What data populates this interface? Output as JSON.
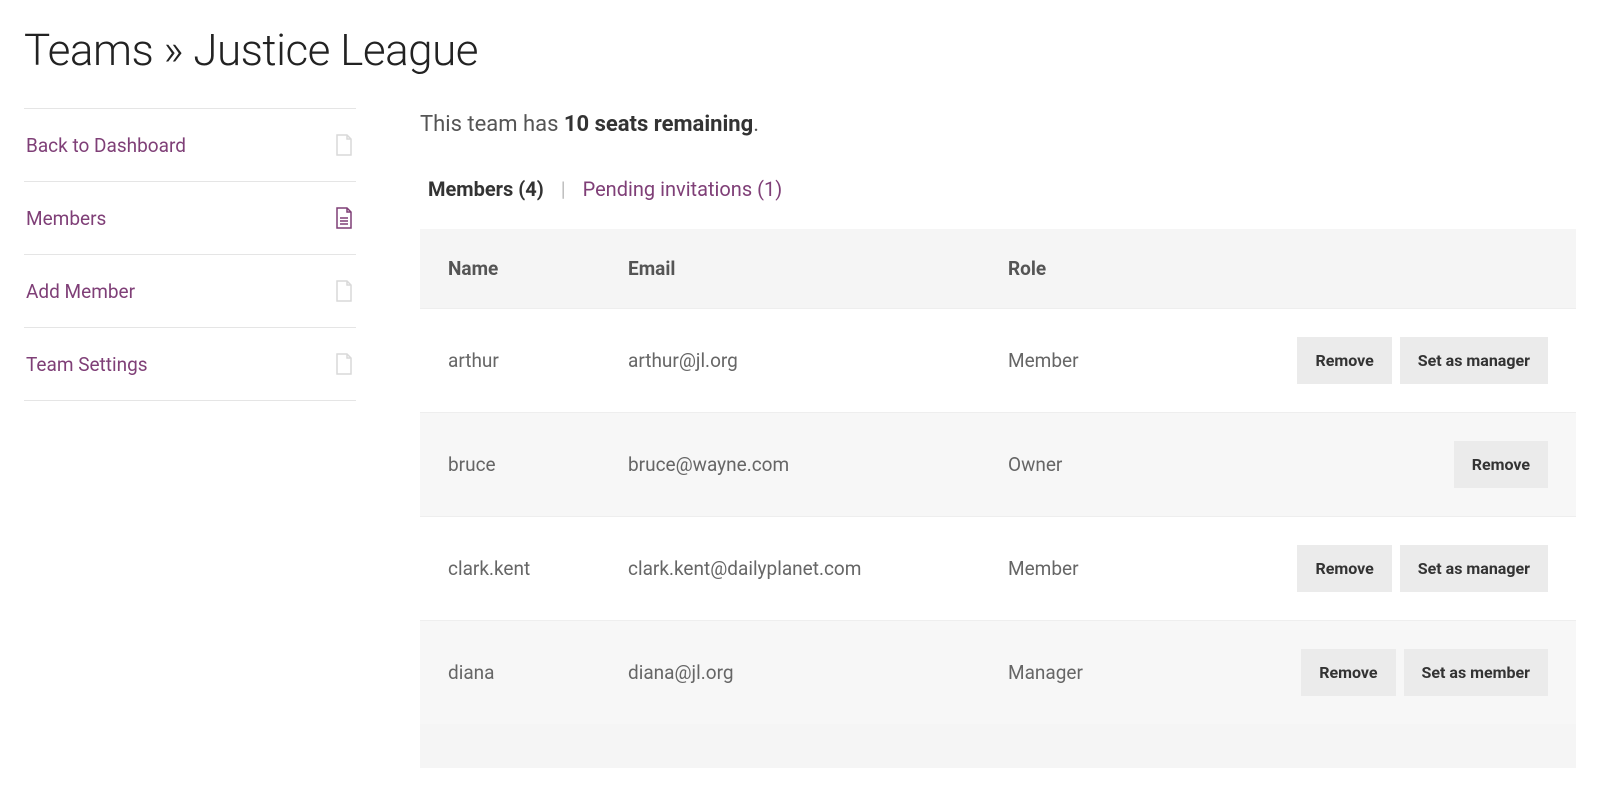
{
  "title": "Teams » Justice League",
  "sidebar": {
    "items": [
      {
        "label": "Back to Dashboard",
        "active": false
      },
      {
        "label": "Members",
        "active": true
      },
      {
        "label": "Add Member",
        "active": false
      },
      {
        "label": "Team Settings",
        "active": false
      }
    ]
  },
  "seats": {
    "prefix": "This team has ",
    "strong": "10 seats remaining",
    "suffix": "."
  },
  "tabs": {
    "members_label": "Members (4)",
    "separator": "|",
    "pending_label": "Pending invitations (1)"
  },
  "table": {
    "headers": {
      "name": "Name",
      "email": "Email",
      "role": "Role"
    },
    "rows": [
      {
        "name": "arthur",
        "email": "arthur@jl.org",
        "role": "Member",
        "actions": [
          "Remove",
          "Set as manager"
        ]
      },
      {
        "name": "bruce",
        "email": "bruce@wayne.com",
        "role": "Owner",
        "actions": [
          "Remove"
        ]
      },
      {
        "name": "clark.kent",
        "email": "clark.kent@dailyplanet.com",
        "role": "Member",
        "actions": [
          "Remove",
          "Set as manager"
        ]
      },
      {
        "name": "diana",
        "email": "diana@jl.org",
        "role": "Manager",
        "actions": [
          "Remove",
          "Set as member"
        ]
      }
    ]
  }
}
